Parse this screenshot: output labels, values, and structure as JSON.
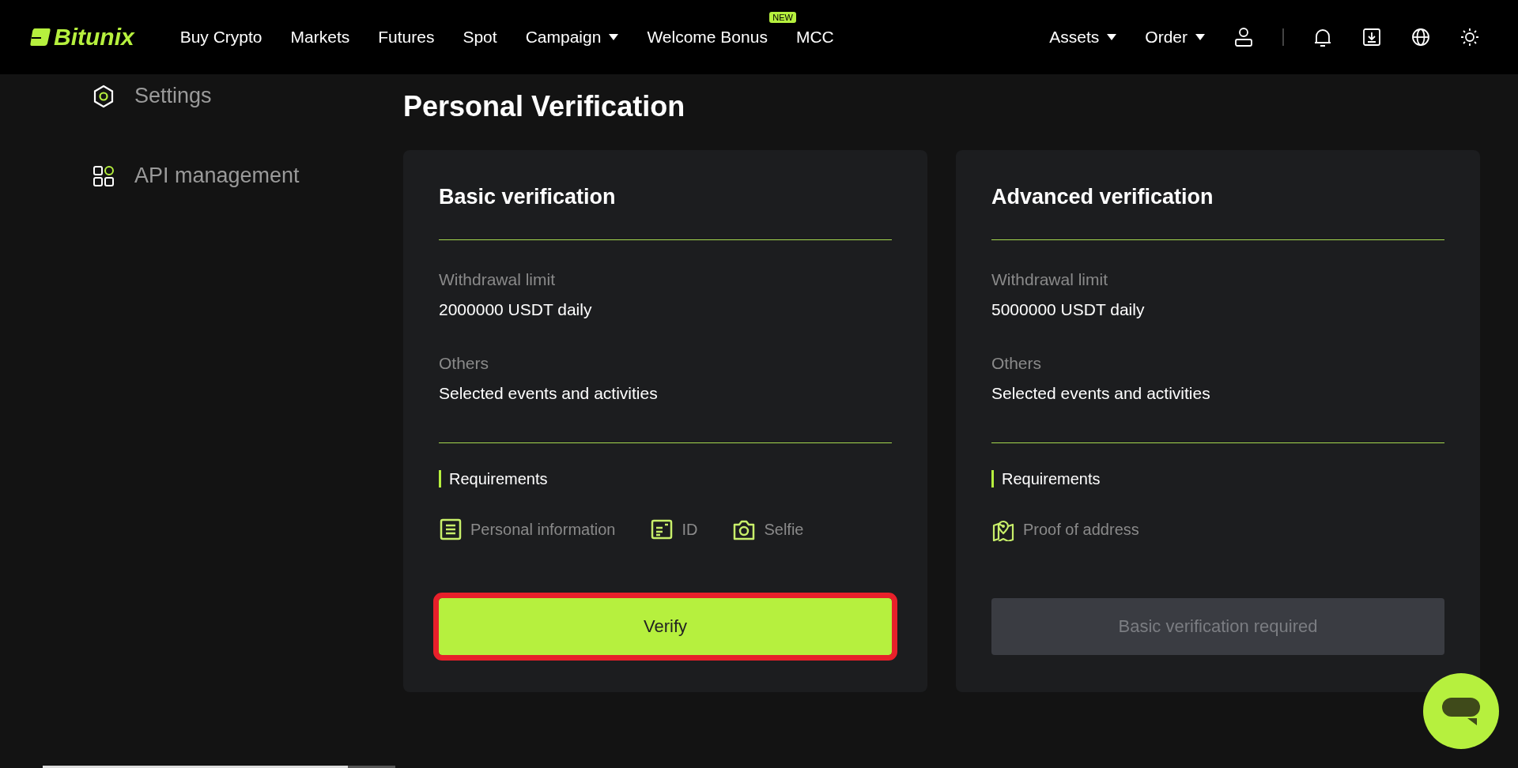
{
  "header": {
    "logo": "Bitunix",
    "nav": [
      {
        "label": "Buy Crypto",
        "dropdown": false
      },
      {
        "label": "Markets",
        "dropdown": false
      },
      {
        "label": "Futures",
        "dropdown": false
      },
      {
        "label": "Spot",
        "dropdown": false
      },
      {
        "label": "Campaign",
        "dropdown": true
      },
      {
        "label": "Welcome Bonus",
        "dropdown": false,
        "badge": "NEW"
      },
      {
        "label": "MCC",
        "dropdown": false
      }
    ],
    "right_menu": [
      {
        "label": "Assets",
        "dropdown": true
      },
      {
        "label": "Order",
        "dropdown": true
      }
    ]
  },
  "sidebar": {
    "items": [
      {
        "label": "Settings",
        "kind": "settings"
      },
      {
        "label": "API management",
        "kind": "api"
      }
    ]
  },
  "page_title": "Personal Verification",
  "cards": [
    {
      "title": "Basic verification",
      "fields": [
        {
          "label": "Withdrawal limit",
          "value": "2000000 USDT daily"
        },
        {
          "label": "Others",
          "value": "Selected events and activities"
        }
      ],
      "requirements_title": "Requirements",
      "requirements": [
        {
          "label": "Personal information",
          "kind": "document"
        },
        {
          "label": "ID",
          "kind": "id"
        },
        {
          "label": "Selfie",
          "kind": "camera"
        }
      ],
      "button": {
        "label": "Verify",
        "disabled": false,
        "highlighted": true
      }
    },
    {
      "title": "Advanced verification",
      "fields": [
        {
          "label": "Withdrawal limit",
          "value": "5000000 USDT daily"
        },
        {
          "label": "Others",
          "value": "Selected events and activities"
        }
      ],
      "requirements_title": "Requirements",
      "requirements": [
        {
          "label": "Proof of address",
          "kind": "map"
        }
      ],
      "button": {
        "label": "Basic verification required",
        "disabled": true,
        "highlighted": false
      }
    }
  ]
}
